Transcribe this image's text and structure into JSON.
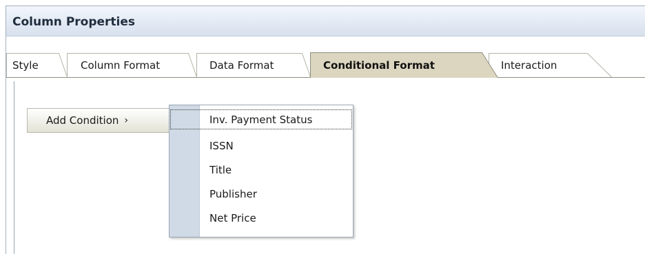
{
  "panel": {
    "title": "Column Properties"
  },
  "tabs": [
    {
      "label": "Style",
      "active": false
    },
    {
      "label": "Column Format",
      "active": false
    },
    {
      "label": "Data Format",
      "active": false
    },
    {
      "label": "Conditional Format",
      "active": true
    },
    {
      "label": "Interaction",
      "active": false
    }
  ],
  "add_condition": {
    "label": "Add Condition",
    "chevron": "›"
  },
  "condition_menu": {
    "items": [
      {
        "label": "Inv. Payment Status",
        "focused": true
      },
      {
        "label": "ISSN",
        "focused": false
      },
      {
        "label": "Title",
        "focused": false
      },
      {
        "label": "Publisher",
        "focused": false
      },
      {
        "label": "Net Price",
        "focused": false
      }
    ]
  },
  "colors": {
    "title_text": "#1f2d3d",
    "active_tab_fill": "#dcd6c0",
    "menu_gutter": "#cfdae6",
    "border": "#9da7b5"
  }
}
